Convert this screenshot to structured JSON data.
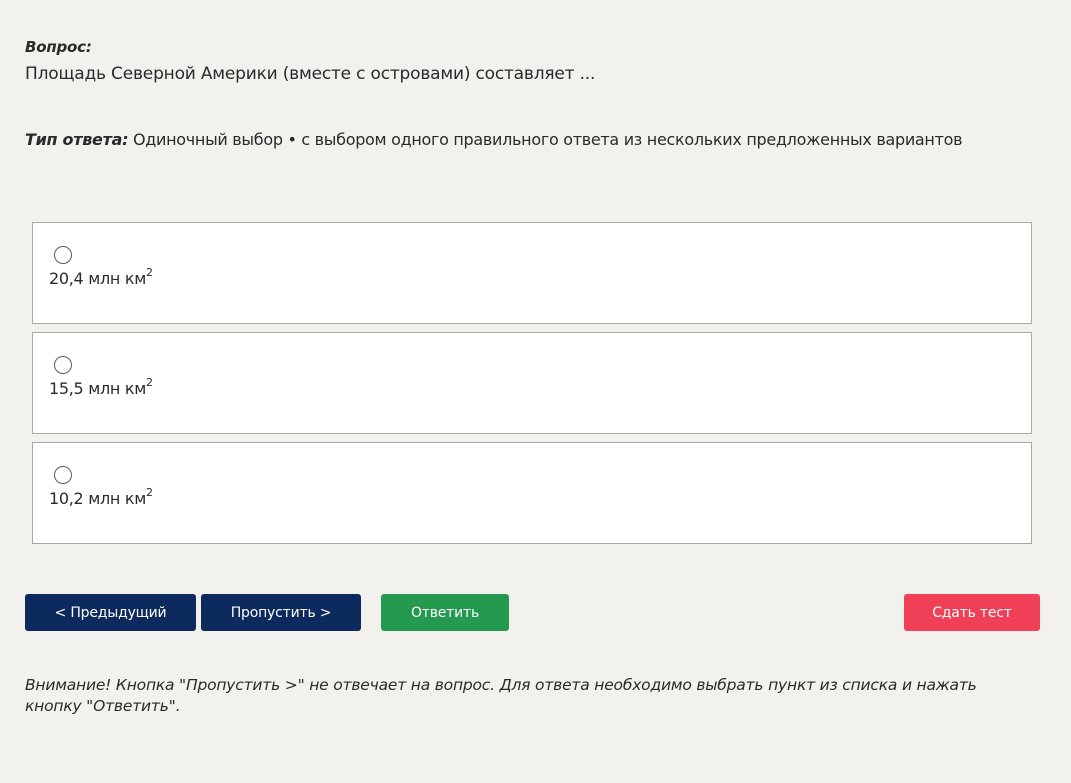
{
  "question": {
    "label": "Вопрос:",
    "text": "Площадь Северной Америки (вместе с островами) составляет ..."
  },
  "answer_type": {
    "label": "Тип ответа:",
    "value": "Одиночный выбор • с выбором одного правильного ответа из нескольких предложенных вариантов"
  },
  "options": [
    {
      "text": "20,4 млн км",
      "sup": "2",
      "selected": false
    },
    {
      "text": "15,5 млн км",
      "sup": "2",
      "selected": false
    },
    {
      "text": "10,2 млн км",
      "sup": "2",
      "selected": false
    }
  ],
  "buttons": {
    "prev": "< Предыдущий",
    "skip": "Пропустить >",
    "answer": "Ответить",
    "submit": "Сдать тест"
  },
  "warning": "Внимание! Кнопка \"Пропустить >\" не отвечает на вопрос. Для ответа необходимо выбрать пункт из списка и нажать кнопку \"Ответить\".",
  "colors": {
    "primary_button": "#0c2a5d",
    "answer_button": "#24994f",
    "submit_button": "#f04057",
    "background": "#f2f1ee"
  }
}
